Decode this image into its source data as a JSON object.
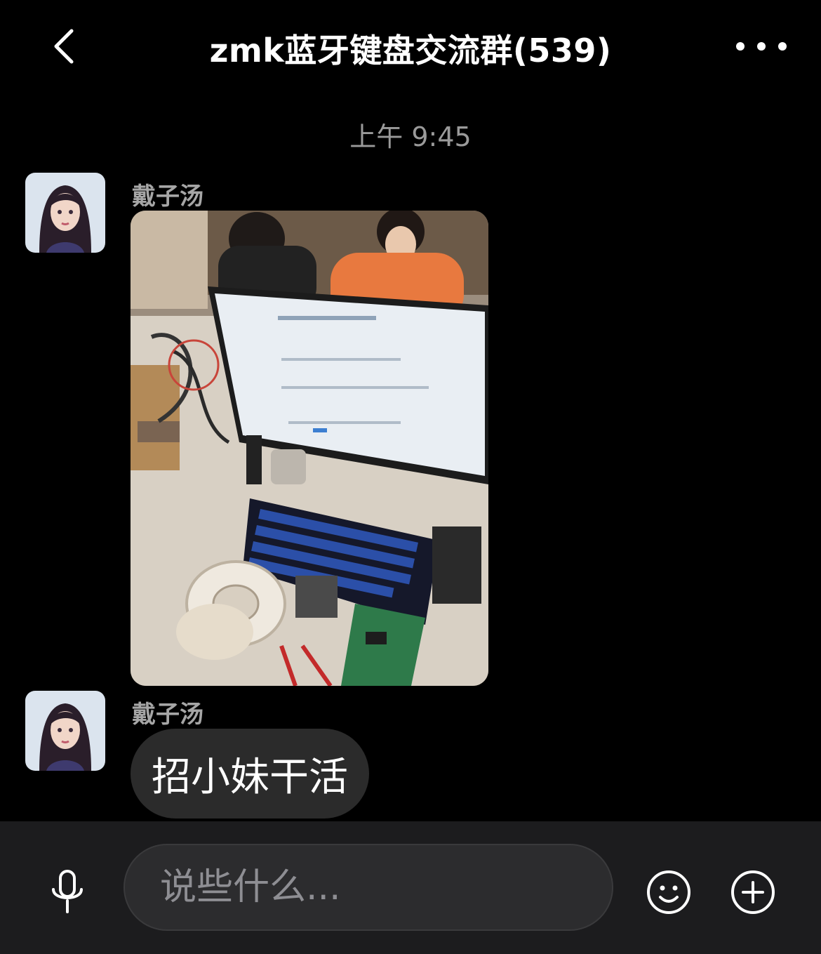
{
  "header": {
    "title": "zmk蓝牙键盘交流群(539)",
    "back_icon": "chevron-left-icon",
    "more_icon": "ellipsis-icon"
  },
  "timestamp": "上午 9:45",
  "messages": [
    {
      "sender": "戴子汤",
      "type": "image",
      "image_description": "photo of a cluttered workbench with monitor, blue keyboard, tape rolls and circuit boards"
    },
    {
      "sender": "戴子汤",
      "type": "text",
      "text": "招小妹干活"
    }
  ],
  "composer": {
    "placeholder": "说些什么...",
    "mic_icon": "microphone-icon",
    "emoji_icon": "emoji-icon",
    "plus_icon": "plus-icon"
  },
  "colors": {
    "background": "#000000",
    "bubble": "#2b2b2b",
    "composer_bar": "#1c1c1e",
    "muted_text": "#9a9a9a"
  }
}
